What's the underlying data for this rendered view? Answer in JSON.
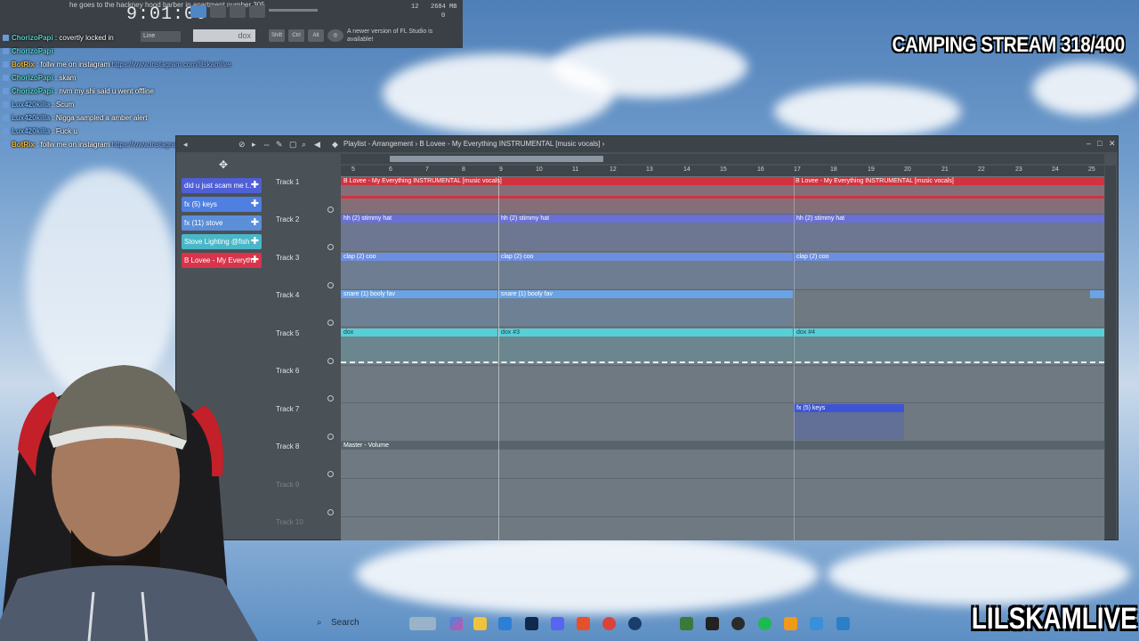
{
  "flbar": {
    "ticker": "he goes to the hackney hood barber in apartment number 305",
    "clock": "9:01:00",
    "cpu": "12",
    "mem": "2684 MB",
    "mem2": "0",
    "mode": "Line",
    "pattern": "dox",
    "news": "A newer version of FL Studio is available!"
  },
  "chat": [
    {
      "user": "ChorizoPapi",
      "msg": "covertly locked in"
    },
    {
      "user": "ChorizoPapi",
      "msg": ""
    },
    {
      "user": "BotRix",
      "msg": "follw me on instagram",
      "link": "https://www.instagram.com/lilskamlive"
    },
    {
      "user": "ChorizoPapi",
      "msg": "skam"
    },
    {
      "user": "ChorizoPapi",
      "msg": "nvm my shi said u went offline"
    },
    {
      "user": "Lux420killa",
      "msg": "Scum"
    },
    {
      "user": "Lux420killa",
      "msg": "Nigga sampled a amber alert"
    },
    {
      "user": "Lux420killa",
      "msg": "Fuck u"
    },
    {
      "user": "BotRix",
      "msg": "follw me on instagram",
      "link": "https://www.instagram.com/lilskamlive"
    }
  ],
  "overlay": {
    "camping": "CAMPING STREAM 318/400",
    "brand": "LILSKAMLIVE"
  },
  "playlist": {
    "title": "Playlist - Arrangement › B Lovee - My Everything INSTRUMENTAL [music vocals] ›",
    "picker": [
      {
        "label": "did u just scam me t..",
        "color": "#4f5fd6"
      },
      {
        "label": "fx (5) keys",
        "color": "#4f7fe0"
      },
      {
        "label": "fx (11) stove",
        "color": "#5b8fd8"
      },
      {
        "label": "Stove Lighting @fish",
        "color": "#49b7c8"
      },
      {
        "label": "B Lovee - My Everyth..",
        "color": "#d8344a"
      }
    ],
    "tracks": [
      "Track 1",
      "Track 2",
      "Track 3",
      "Track 4",
      "Track 5",
      "Track 6",
      "Track 7",
      "Track 8",
      "Track 9",
      "Track 10"
    ],
    "ruler": [
      "5",
      "6",
      "7",
      "8",
      "9",
      "10",
      "11",
      "12",
      "13",
      "14",
      "15",
      "16",
      "17",
      "18",
      "19",
      "20",
      "21",
      "22",
      "23",
      "24",
      "25"
    ],
    "clips": {
      "t1a": "B Lovee - My Everything INSTRUMENTAL [music vocals]",
      "t1b": "B Lovee - My Everything INSTRUMENTAL [music vocals]",
      "t2a": "hh (2) stimmy hat",
      "t2b": "hh (2) stimmy hat",
      "t2c": "hh (2) stimmy hat",
      "t3a": "clap (2) coo",
      "t3b": "clap (2) coo",
      "t3c": "clap (2) coo",
      "t4a": "snare (1) booly fav",
      "t4b": "snare (1) booly fav",
      "t5a": "dox",
      "t5b": "dox #3",
      "t5c": "dox #4",
      "t7a": "fx (5) keys",
      "t8a": "Master - Volume"
    }
  },
  "taskbar": {
    "search": "Search"
  }
}
